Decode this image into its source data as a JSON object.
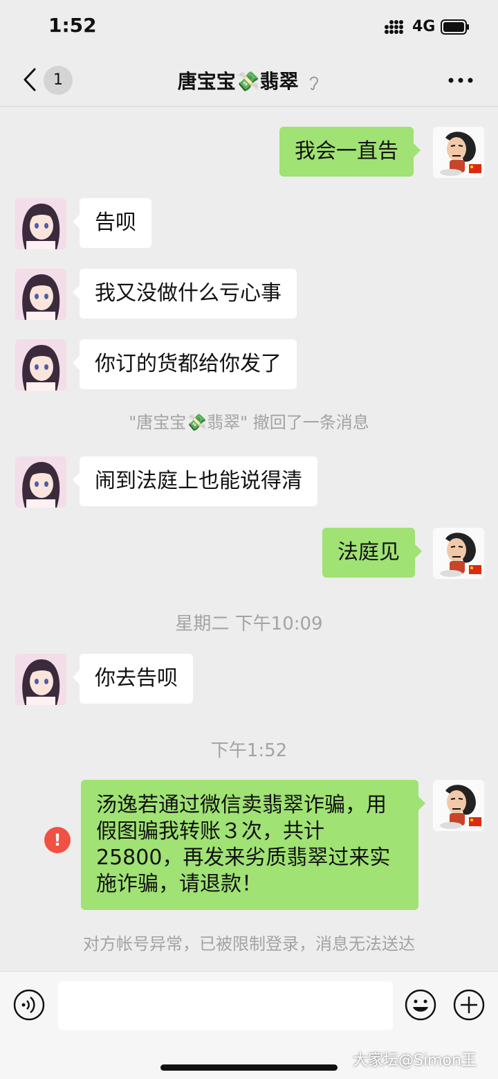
{
  "status": {
    "time": "1:52",
    "network": "4G"
  },
  "header": {
    "unread_count": "1",
    "contact_name": "唐宝宝💸翡翠"
  },
  "messages": [
    {
      "text": "我会一直告"
    },
    {
      "text": "告呗"
    },
    {
      "text": "我又没做什么亏心事"
    },
    {
      "text": "你订的货都给你发了"
    },
    {
      "text": "闹到法庭上也能说得清"
    },
    {
      "text": "法庭见"
    },
    {
      "text": "你去告呗"
    },
    {
      "text": "汤逸若通过微信卖翡翠诈骗，用假图骗我转账３次，共计25800，再发来劣质翡翠过来实施诈骗，请退款！"
    }
  ],
  "system": {
    "recall_notice": "\"唐宝宝💸翡翠\" 撤回了一条消息",
    "timestamp_1": "星期二 下午10:09",
    "timestamp_2": "下午1:52",
    "delivery_failed": "对方帐号异常，已被限制登录，消息无法送达"
  },
  "failed_marker": "!",
  "watermark": "大家坛@Simon王",
  "colors": {
    "background": "#ededed",
    "outgoing_bubble": "#a0e274",
    "incoming_bubble": "#ffffff",
    "error": "#f05142"
  }
}
